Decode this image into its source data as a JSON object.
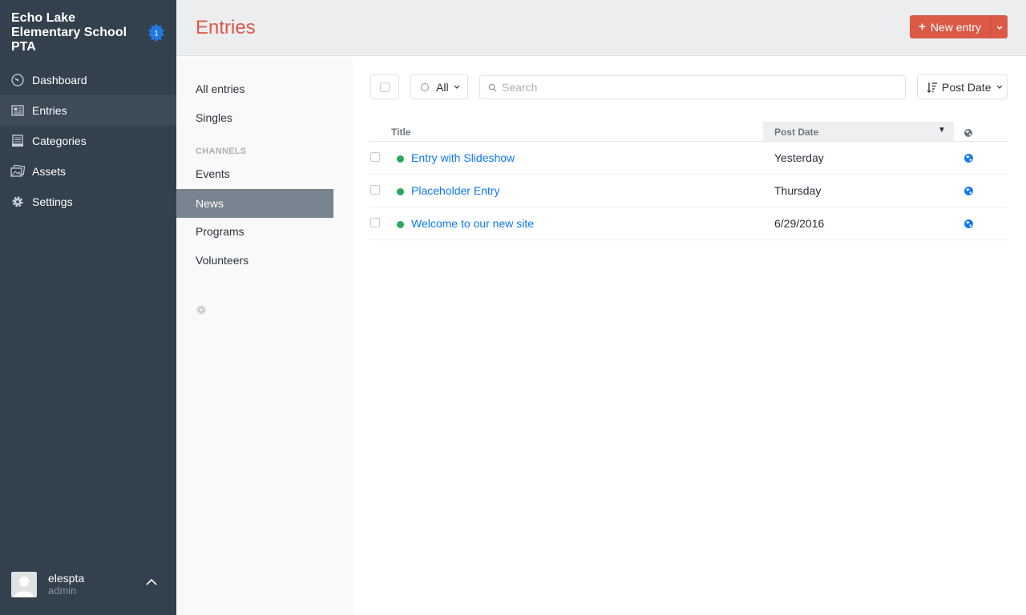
{
  "site": {
    "name": "Echo Lake Elementary School PTA",
    "update_count": "1"
  },
  "nav": [
    {
      "label": "Dashboard",
      "icon": "dashboard-icon"
    },
    {
      "label": "Entries",
      "icon": "entries-icon",
      "selected": true
    },
    {
      "label": "Categories",
      "icon": "categories-icon"
    },
    {
      "label": "Assets",
      "icon": "assets-icon"
    },
    {
      "label": "Settings",
      "icon": "gear-icon"
    }
  ],
  "user": {
    "name": "elespta",
    "role": "admin"
  },
  "header": {
    "title": "Entries",
    "new_entry_label": "New entry"
  },
  "sources": {
    "all_entries": "All entries",
    "singles": "Singles",
    "channels_heading": "CHANNELS",
    "channels": [
      "Events",
      "News",
      "Programs",
      "Volunteers"
    ],
    "selected": "News"
  },
  "toolbar": {
    "status_label": "All",
    "search_placeholder": "Search",
    "sort_label": "Post Date"
  },
  "table": {
    "columns": {
      "title": "Title",
      "post_date": "Post Date"
    },
    "rows": [
      {
        "title": "Entry with Slideshow",
        "post_date": "Yesterday",
        "status": "live"
      },
      {
        "title": "Placeholder Entry",
        "post_date": "Thursday",
        "status": "live"
      },
      {
        "title": "Welcome to our new site",
        "post_date": "6/29/2016",
        "status": "live"
      }
    ]
  },
  "colors": {
    "sidebar_bg": "#33404d",
    "accent_red": "#da5a47",
    "link_blue": "#0d78f2",
    "status_green": "#27ab5a",
    "selected_source_bg": "#78848f"
  }
}
